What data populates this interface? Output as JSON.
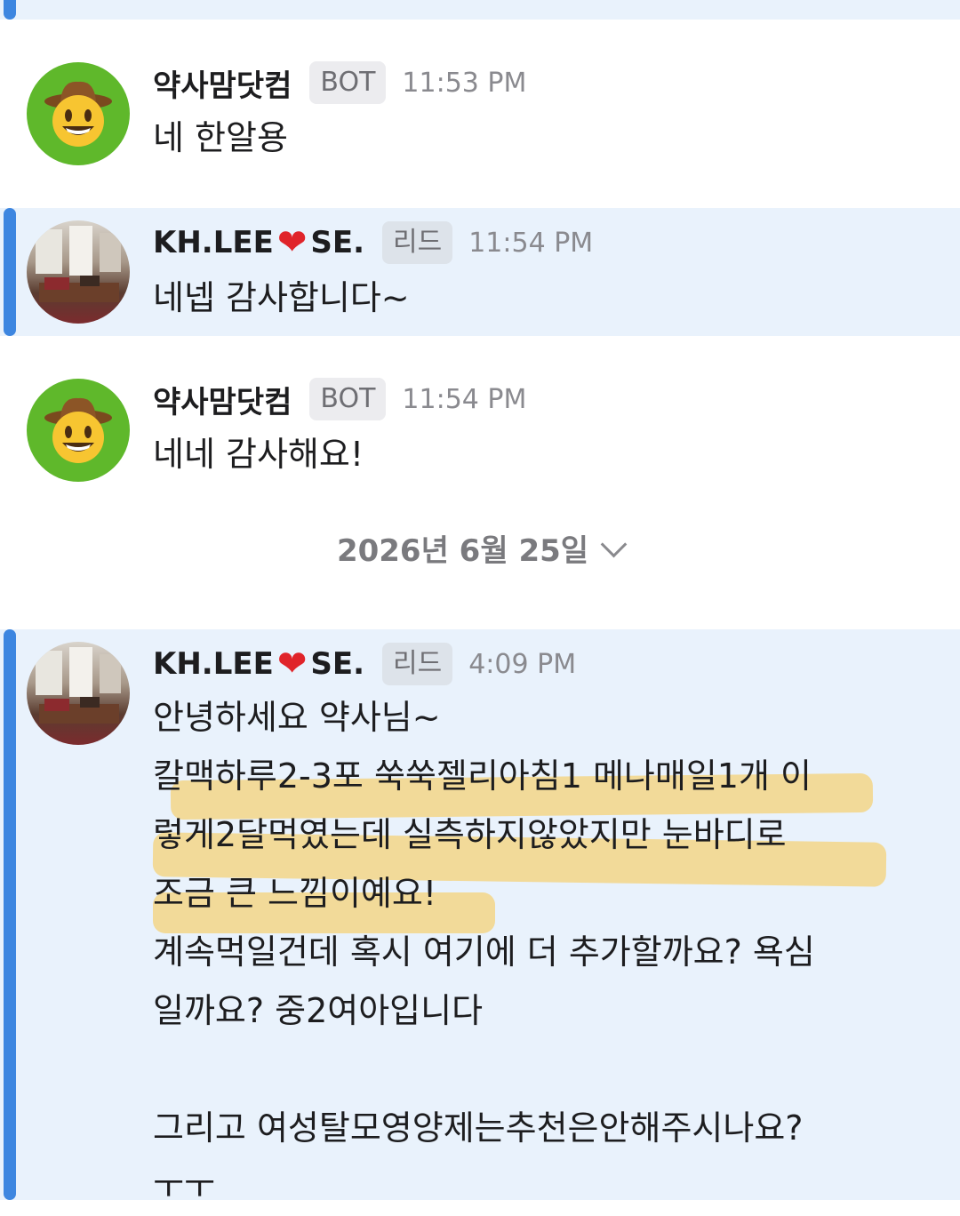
{
  "messages": [
    {
      "author": "약사맘닷컴",
      "badge": "BOT",
      "time": "11:53 PM",
      "lines": [
        "네 한알용"
      ]
    },
    {
      "author_a": "KH.LEE",
      "heart": "❤",
      "author_b": "SE.",
      "badge": "리드",
      "time": "11:54 PM",
      "lines": [
        "네넵 감사합니다~"
      ]
    },
    {
      "author": "약사맘닷컴",
      "badge": "BOT",
      "time": "11:54 PM",
      "lines": [
        "네네 감사해요!"
      ]
    },
    {
      "author_a": "KH.LEE",
      "heart": "❤",
      "author_b": "SE.",
      "badge": "리드",
      "time": "4:09 PM",
      "lines": [
        "안녕하세요 약사님~",
        "칼맥하루2-3포 쑥쑥젤리아침1 메나매일1개 이",
        "렇게2달먹였는데 실측하지않았지만 눈바디로",
        "조금 큰 느낌이예요!",
        "계속먹일건데 혹시 여기에 더 추가할까요? 욕심",
        "일까요? 중2여아입니다",
        "그리고 여성탈모영양제는추천은안해주시나요?",
        "ㅜㅜ"
      ]
    }
  ],
  "date_divider": "2026년 6월 25일",
  "icons": {
    "bot_avatar": "cowboy-emoji-icon",
    "user_avatar": "room-photo",
    "divider": "chevron-down-icon"
  }
}
